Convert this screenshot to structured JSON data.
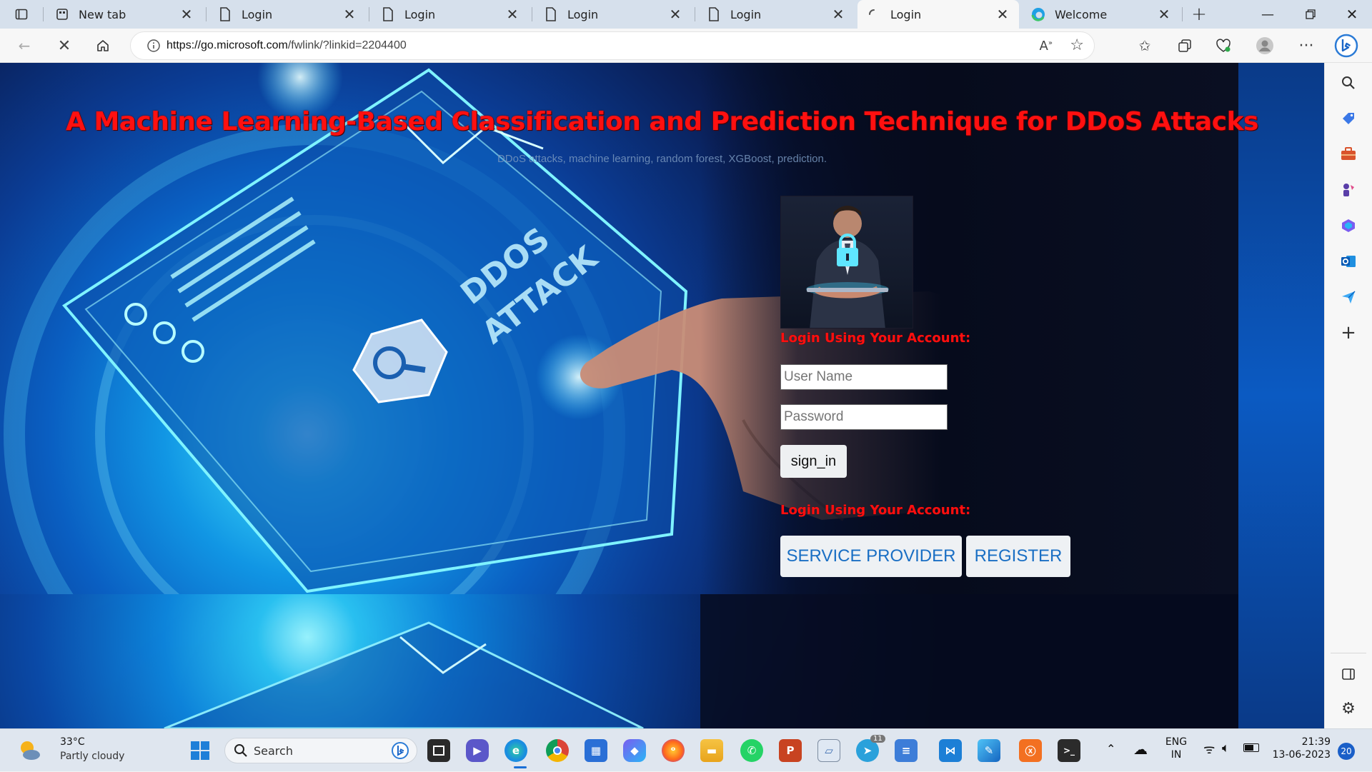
{
  "browser": {
    "tabs": [
      {
        "label": "New tab",
        "icon": "newtab-icon"
      },
      {
        "label": "Login",
        "icon": "page-icon"
      },
      {
        "label": "Login",
        "icon": "page-icon"
      },
      {
        "label": "Login",
        "icon": "page-icon"
      },
      {
        "label": "Login",
        "icon": "page-icon"
      },
      {
        "label": "Login",
        "icon": "loading-icon",
        "active": true
      },
      {
        "label": "Welcome",
        "icon": "edge-icon"
      }
    ],
    "url_host": "https://go.microsoft.com",
    "url_path": "/fwlink/?linkid=2204400"
  },
  "page": {
    "title": "A Machine Learning-Based Classification and Prediction Technique for DDoS Attacks",
    "keywords": "DDoS attacks, machine learning, random forest, XGBoost, prediction.",
    "login_heading": "Login Using Your Account:",
    "username_placeholder": "User Name",
    "password_placeholder": "Password",
    "signin_label": "sign_in",
    "login_heading_2": "Login Using Your Account:",
    "service_provider_label": "SERVICE PROVIDER",
    "register_label": "REGISTER"
  },
  "taskbar": {
    "weather_temp": "33°C",
    "weather_desc": "Partly cloudy",
    "search_label": "Search",
    "lang_top": "ENG",
    "lang_bottom": "IN",
    "time": "21:39",
    "date": "13-06-2023",
    "notification_count": "20",
    "telegram_badge": "11"
  }
}
